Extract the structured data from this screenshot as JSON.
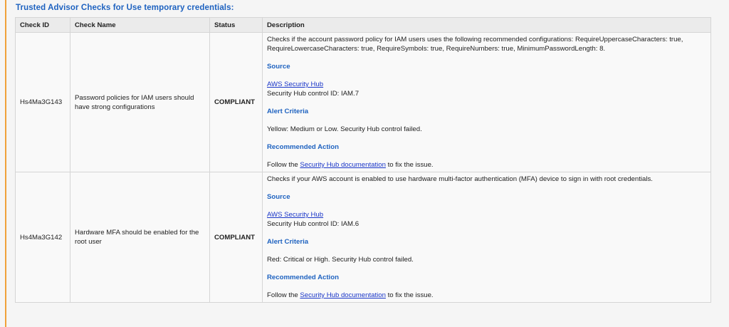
{
  "section": {
    "title": "Trusted Advisor Checks for Use temporary credentials:"
  },
  "table": {
    "headers": {
      "check_id": "Check ID",
      "check_name": "Check Name",
      "status": "Status",
      "description": "Description"
    },
    "rows": [
      {
        "check_id": "Hs4Ma3G143",
        "check_name": "Password policies for IAM users should have strong configurations",
        "status": "COMPLIANT",
        "description": {
          "summary": "Checks if the account password policy for IAM users uses the following recommended configurations: RequireUppercaseCharacters: true, RequireLowercaseCharacters: true, RequireSymbols: true, RequireNumbers: true, MinimumPasswordLength: 8.",
          "source_heading": "Source",
          "source_link": "AWS Security Hub",
          "source_control": "Security Hub control ID: IAM.7",
          "alert_heading": "Alert Criteria",
          "alert_text": "Yellow: Medium or Low. Security Hub control failed.",
          "action_heading": "Recommended Action",
          "action_prefix": "Follow the ",
          "action_link": "Security Hub documentation",
          "action_suffix": " to fix the issue."
        }
      },
      {
        "check_id": "Hs4Ma3G142",
        "check_name": "Hardware MFA should be enabled for the root user",
        "status": "COMPLIANT",
        "description": {
          "summary": "Checks if your AWS account is enabled to use hardware multi-factor authentication (MFA) device to sign in with root credentials.",
          "source_heading": "Source",
          "source_link": "AWS Security Hub",
          "source_control": "Security Hub control ID: IAM.6",
          "alert_heading": "Alert Criteria",
          "alert_text": "Red: Critical or High. Security Hub control failed.",
          "action_heading": "Recommended Action",
          "action_prefix": "Follow the ",
          "action_link": "Security Hub documentation",
          "action_suffix": " to fix the issue."
        }
      }
    ]
  },
  "colors": {
    "heading_blue": "#1e62c0",
    "link_blue": "#1a36c8",
    "compliant_green": "#1e8a1e",
    "accent_orange": "#f0a23a"
  }
}
